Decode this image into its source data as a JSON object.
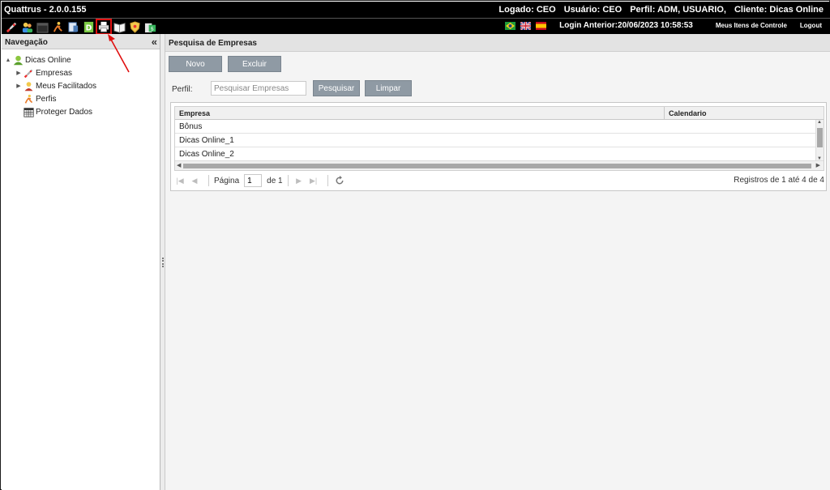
{
  "window": {
    "title": "Quattrus - 2.0.0.155",
    "session": {
      "logado": "Logado: CEO",
      "usuario": "Usuário: CEO",
      "perfil": "Perfil: ADM, USUARIO,",
      "cliente": "Cliente: Dicas Online"
    }
  },
  "toolbar": {
    "icons": [
      "rocket-icon",
      "users-icon",
      "calendar-icon",
      "person-run-icon",
      "document-icon",
      "book-green-icon",
      "printer-icon",
      "book-open-icon",
      "shield-icon",
      "money-icon"
    ],
    "login_anterior": "Login Anterior:20/06/2023 10:58:53",
    "meus_itens": "Meus Itens de Controle",
    "logout": "Logout",
    "flags": [
      "brazil-flag-icon",
      "uk-flag-icon",
      "spain-flag-icon"
    ]
  },
  "nav": {
    "title": "Navegação",
    "collapse": "«",
    "tree": [
      {
        "label": "Dicas Online",
        "level": 0,
        "expander": "▲"
      },
      {
        "label": "Empresas",
        "level": 1,
        "expander": "▶"
      },
      {
        "label": "Meus Facilitados",
        "level": 1,
        "expander": "▶"
      },
      {
        "label": "Perfis",
        "level": 1,
        "expander": ""
      },
      {
        "label": "Proteger Dados",
        "level": 1,
        "expander": ""
      }
    ]
  },
  "main": {
    "title": "Pesquisa de Empresas",
    "buttons": {
      "novo": "Novo",
      "excluir": "Excluir",
      "pesquisar": "Pesquisar",
      "limpar": "Limpar"
    },
    "filter": {
      "label": "Perfil:",
      "placeholder": "Pesquisar Empresas",
      "value": ""
    },
    "grid": {
      "columns": [
        "Empresa",
        "Calendario"
      ],
      "rows": [
        "Bônus",
        "Dicas Online_1",
        "Dicas Online_2"
      ]
    },
    "pager": {
      "page_label": "Página",
      "page": "1",
      "of_label": "de 1",
      "records": "Registros de 1 até 4 de 4"
    }
  },
  "colors": {
    "button": "#8f9aa4",
    "titlebar": "#000000",
    "annotation": "#e01010"
  }
}
